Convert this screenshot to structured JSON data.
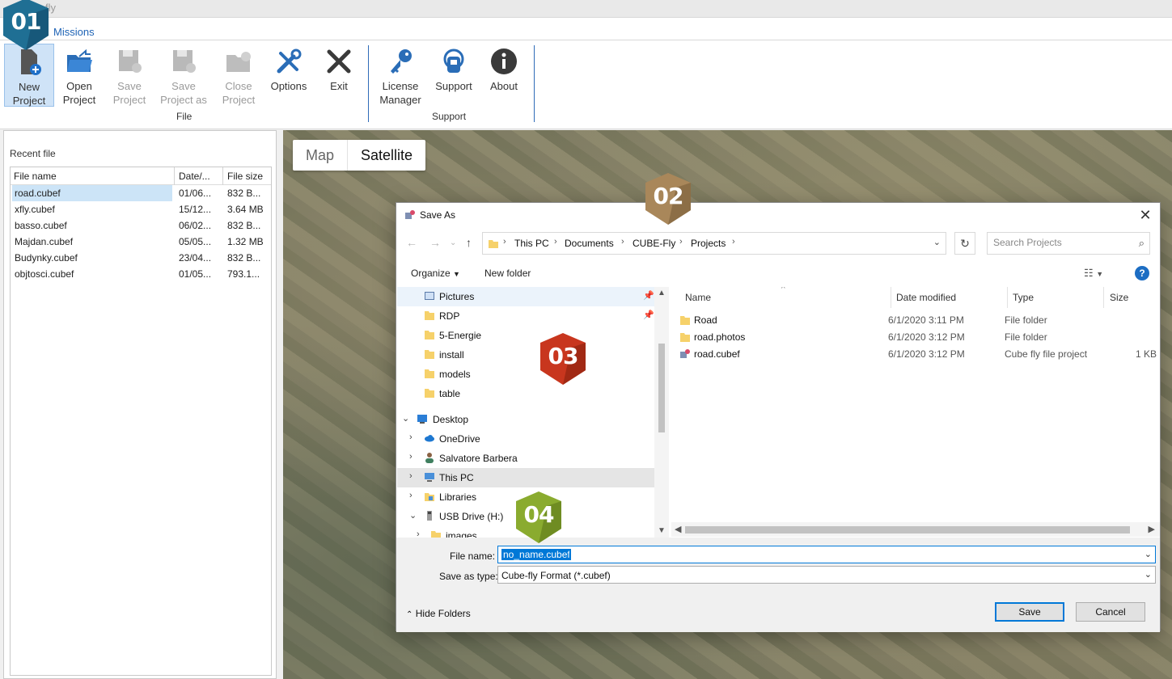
{
  "app": {
    "title": "fly"
  },
  "ribbon": {
    "tab": "Missions",
    "buttons": [
      {
        "label": "New Project",
        "icon": "new-project-icon",
        "state": "active"
      },
      {
        "label": "Open Project",
        "icon": "open-folder-icon",
        "state": "enabled"
      },
      {
        "label": "Save Project",
        "icon": "save-icon",
        "state": "disabled"
      },
      {
        "label": "Save Project as",
        "icon": "save-as-icon",
        "state": "disabled"
      },
      {
        "label": "Close Project",
        "icon": "close-folder-icon",
        "state": "disabled"
      },
      {
        "label": "Options",
        "icon": "tools-icon",
        "state": "enabled"
      },
      {
        "label": "Exit",
        "icon": "exit-x-icon",
        "state": "enabled"
      },
      {
        "label": "License Manager",
        "icon": "key-icon",
        "state": "enabled"
      },
      {
        "label": "Support",
        "icon": "support-headset-icon",
        "state": "enabled"
      },
      {
        "label": "About",
        "icon": "info-icon",
        "state": "enabled"
      }
    ],
    "groups": {
      "file": "File",
      "support": "Support"
    }
  },
  "recent": {
    "label": "Recent file",
    "columns": [
      "File name",
      "Date/...",
      "File size"
    ],
    "rows": [
      {
        "name": "road.cubef",
        "date": "01/06...",
        "size": "832 B...",
        "selected": true
      },
      {
        "name": "xfly.cubef",
        "date": "15/12...",
        "size": "3.64 MB"
      },
      {
        "name": "basso.cubef",
        "date": "06/02...",
        "size": "832 B..."
      },
      {
        "name": "Majdan.cubef",
        "date": "05/05...",
        "size": "1.32 MB"
      },
      {
        "name": "Budynky.cubef",
        "date": "23/04...",
        "size": "832 B..."
      },
      {
        "name": "objtosci.cubef",
        "date": "01/05...",
        "size": "793.1..."
      }
    ]
  },
  "map": {
    "toggle": [
      "Map",
      "Satellite"
    ],
    "selected": "Satellite"
  },
  "badges": [
    "01",
    "02",
    "03",
    "04"
  ],
  "dialog": {
    "title": "Save As",
    "breadcrumb": [
      "This PC",
      "Documents",
      "CUBE-Fly",
      "Projects"
    ],
    "search_placeholder": "Search Projects",
    "organize": "Organize",
    "new_folder": "New folder",
    "help": "?",
    "nav_items": [
      {
        "label": "Pictures",
        "icon": "pictures-icon",
        "pinned": true,
        "level": 1
      },
      {
        "label": "RDP",
        "icon": "folder-icon",
        "pinned": true,
        "level": 1
      },
      {
        "label": "5-Energie",
        "icon": "folder-icon",
        "level": 1
      },
      {
        "label": "install",
        "icon": "folder-icon",
        "level": 1
      },
      {
        "label": "models",
        "icon": "folder-icon",
        "level": 1
      },
      {
        "label": "table",
        "icon": "folder-icon",
        "level": 1
      },
      {
        "label": "Desktop",
        "icon": "desktop-icon",
        "expanded": true,
        "level": 0
      },
      {
        "label": "OneDrive",
        "icon": "onedrive-icon",
        "level": 1
      },
      {
        "label": "Salvatore Barbera",
        "icon": "user-icon",
        "level": 1
      },
      {
        "label": "This PC",
        "icon": "pc-icon",
        "level": 1,
        "selected": true
      },
      {
        "label": "Libraries",
        "icon": "libraries-icon",
        "level": 1
      },
      {
        "label": "USB Drive (H:)",
        "icon": "usb-drive-icon",
        "expanded": true,
        "level": 1
      },
      {
        "label": "images",
        "icon": "folder-icon",
        "level": 2
      }
    ],
    "columns": [
      "Name",
      "Date modified",
      "Type",
      "Size"
    ],
    "files": [
      {
        "name": "Road",
        "date": "6/1/2020 3:11 PM",
        "type": "File folder",
        "size": "",
        "icon": "folder-icon"
      },
      {
        "name": "road.photos",
        "date": "6/1/2020 3:12 PM",
        "type": "File folder",
        "size": "",
        "icon": "folder-icon"
      },
      {
        "name": "road.cubef",
        "date": "6/1/2020 3:12 PM",
        "type": "Cube fly file project",
        "size": "1 KB",
        "icon": "cubef-file-icon"
      }
    ],
    "file_name_label": "File name:",
    "file_name_value": "no_name.cubef",
    "save_type_label": "Save as type:",
    "save_type_value": "Cube-fly Format (*.cubef)",
    "hide_folders": "Hide Folders",
    "save": "Save",
    "cancel": "Cancel"
  },
  "colors": {
    "accent": "#1e63b5",
    "badge01": "#1f6f94",
    "badge02": "#a9875a",
    "badge03": "#c8361e",
    "badge04": "#8aab2f"
  }
}
